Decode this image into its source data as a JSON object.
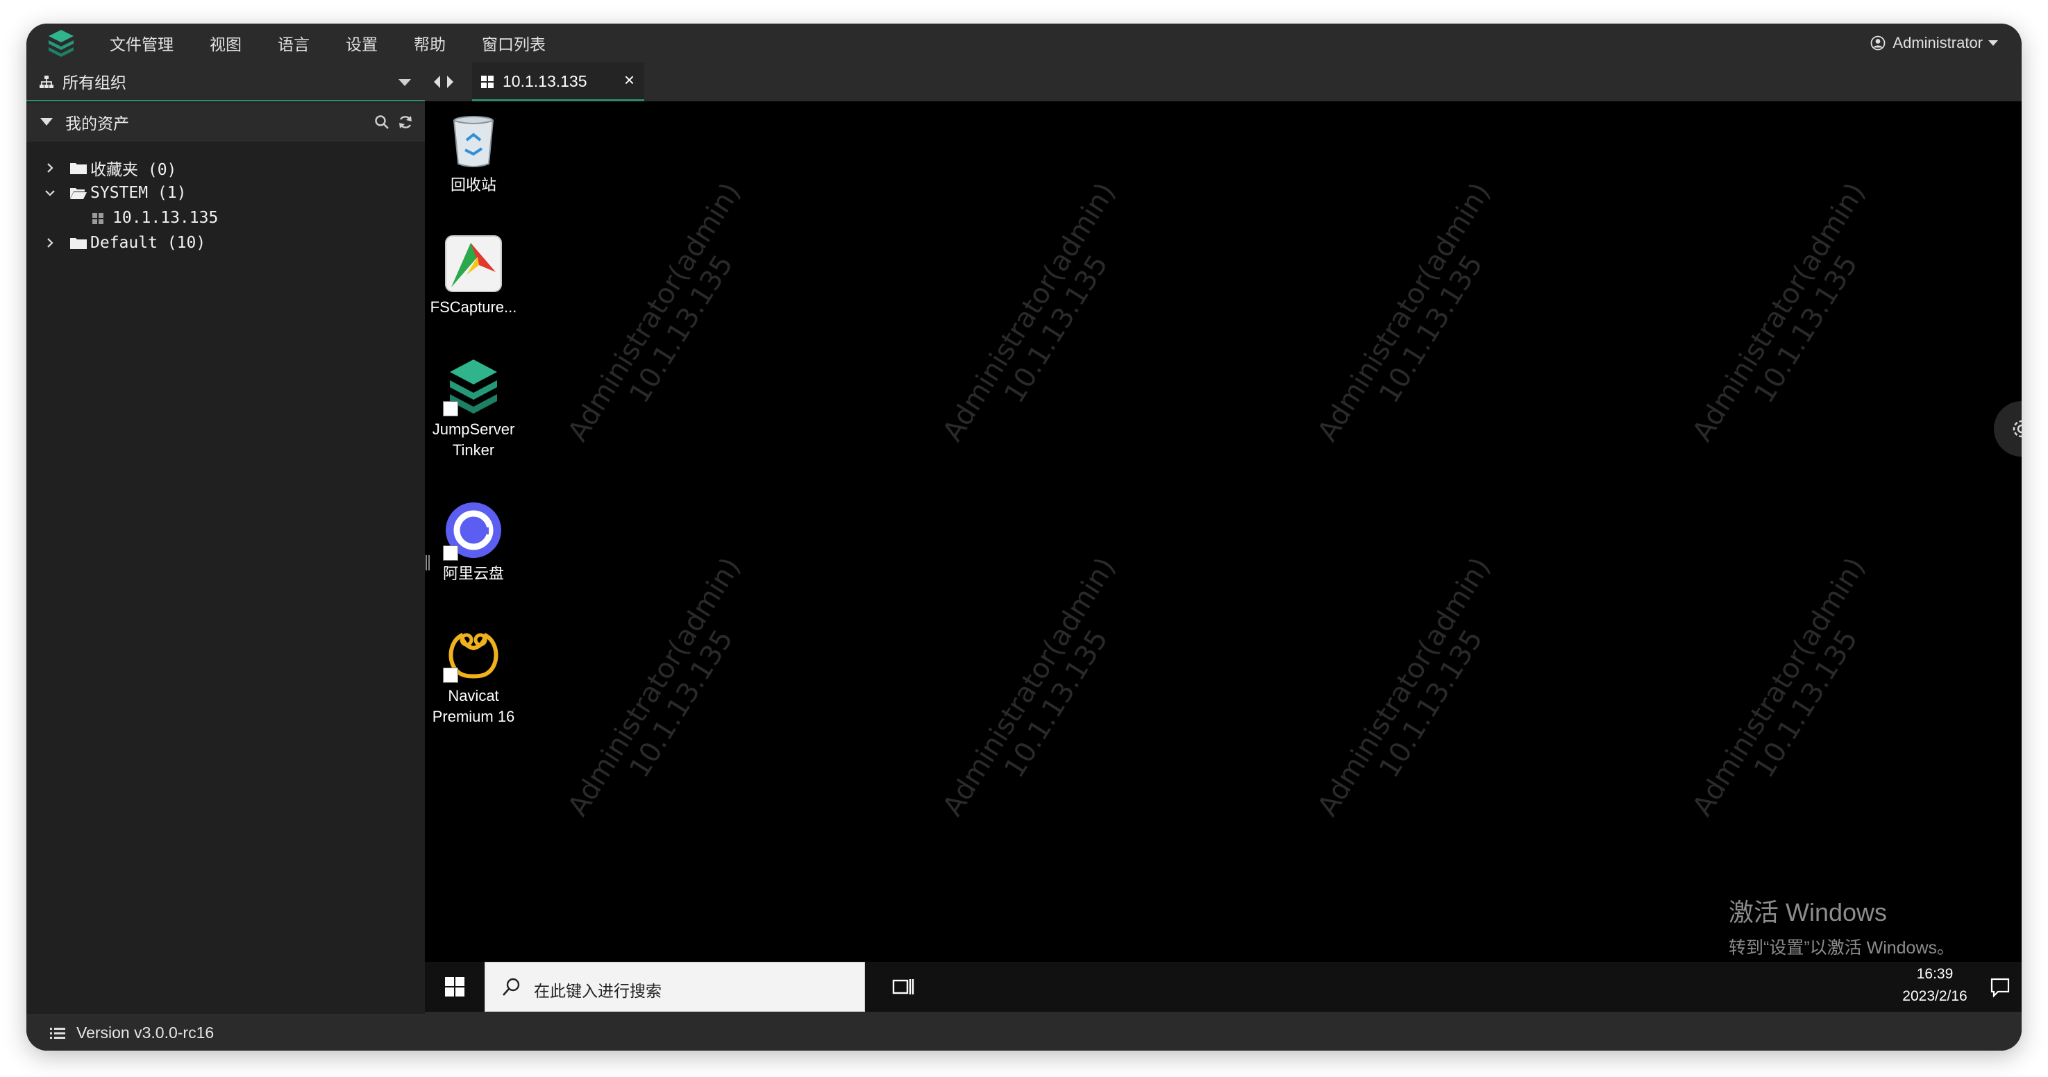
{
  "menubar": {
    "items": [
      "文件管理",
      "视图",
      "语言",
      "设置",
      "帮助",
      "窗口列表"
    ],
    "user": "Administrator"
  },
  "sidebar": {
    "org_label": "所有组织",
    "assets_label": "我的资产",
    "tree": [
      {
        "label": "收藏夹 (0)",
        "expanded": false
      },
      {
        "label": "SYSTEM (1)",
        "expanded": true
      },
      {
        "label": "10.1.13.135",
        "leaf": true
      },
      {
        "label": "Default (10)",
        "expanded": false
      }
    ],
    "version": "Version v3.0.0-rc16"
  },
  "tabs": [
    {
      "label": "10.1.13.135",
      "active": true
    }
  ],
  "desktop": {
    "icons": [
      {
        "label": "回收站",
        "icon": "recycle-bin-icon"
      },
      {
        "label": "FSCapture...",
        "icon": "fscapture-icon"
      },
      {
        "label": "JumpServer Tinker",
        "icon": "jumpserver-tinker-icon",
        "shortcut": true
      },
      {
        "label": "阿里云盘",
        "icon": "aliyun-drive-icon",
        "shortcut": true
      },
      {
        "label": "Navicat Premium 16",
        "icon": "navicat-icon",
        "shortcut": true
      }
    ],
    "watermark": {
      "line1": "Administrator(admin)",
      "line2": "10.1.13.135"
    },
    "activation": {
      "title": "激活 Windows",
      "subtitle": "转到“设置”以激活 Windows。"
    }
  },
  "taskbar": {
    "search_placeholder": "在此键入进行搜索",
    "time": "16:39",
    "date": "2023/2/16"
  },
  "colors": {
    "accent": "#2f8a6f",
    "desktop": "#000000",
    "panel": "#2b2b2b",
    "sidebar": "#202020"
  }
}
